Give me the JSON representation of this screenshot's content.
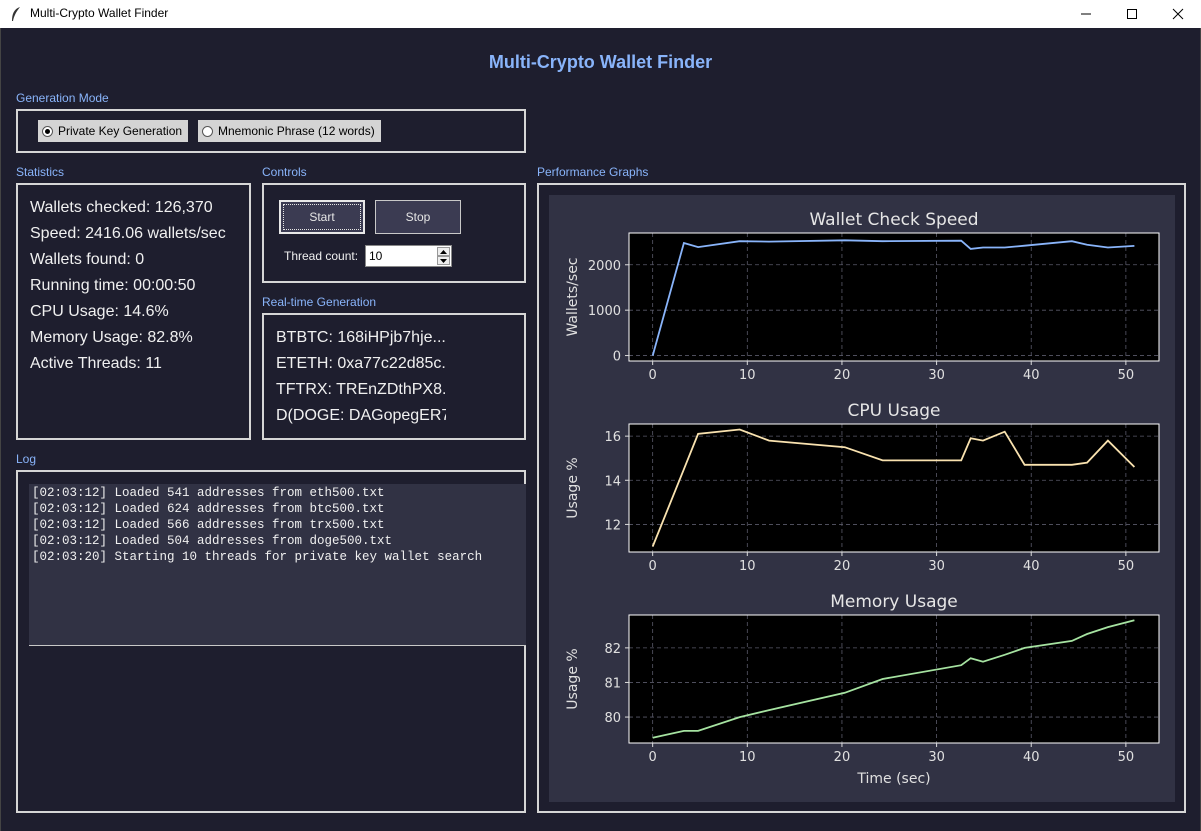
{
  "window": {
    "title": "Multi-Crypto Wallet Finder",
    "icons": [
      "feather-icon",
      "minimize-icon",
      "maximize-icon",
      "close-icon"
    ]
  },
  "heading": "Multi-Crypto Wallet Finder",
  "generation_mode": {
    "label": "Generation Mode",
    "options": [
      {
        "label": "Private Key Generation",
        "selected": true
      },
      {
        "label": "Mnemonic Phrase (12 words)",
        "selected": false
      }
    ]
  },
  "statistics": {
    "label": "Statistics",
    "lines": [
      "Wallets checked: 126,370",
      "Speed: 2416.06 wallets/sec",
      "Wallets found: 0",
      "Running time: 00:00:50",
      "CPU Usage: 14.6%",
      "Memory Usage: 82.8%",
      "Active Threads: 11"
    ]
  },
  "controls": {
    "label": "Controls",
    "start": "Start",
    "stop": "Stop",
    "thread_label": "Thread count:",
    "thread_value": "10"
  },
  "realtime": {
    "label": "Real-time Generation",
    "lines": [
      "BTBTC: 168iHPjb7hje...",
      "ETETH: 0xa77c22d85c...",
      "TFTRX: TREnZDthPX8...",
      "D(DOGE: DAGopegER7..."
    ]
  },
  "log": {
    "label": "Log",
    "lines": [
      "[02:03:12] Loaded 541 addresses from eth500.txt",
      "[02:03:12] Loaded 624 addresses from btc500.txt",
      "[02:03:12] Loaded 566 addresses from trx500.txt",
      "[02:03:12] Loaded 504 addresses from doge500.txt",
      "[02:03:20] Starting 10 threads for private key wallet search"
    ]
  },
  "graphs": {
    "label": "Performance Graphs",
    "colors": {
      "panel": "#313244",
      "plot": "#000000",
      "speed": "#89b4fa",
      "cpu": "#f9e2af",
      "memory": "#a6e3a1"
    }
  },
  "chart_data": [
    {
      "type": "line",
      "title": "Wallet Check Speed",
      "xlabel": "",
      "ylabel": "Wallets/sec",
      "x": [
        0,
        3.3,
        4.8,
        9.2,
        12.3,
        20.3,
        24.3,
        32.6,
        33.6,
        34.9,
        37.2,
        39.3,
        44.3,
        45.9,
        48.1,
        50.9
      ],
      "values": [
        0,
        2480,
        2390,
        2520,
        2510,
        2540,
        2520,
        2530,
        2350,
        2380,
        2380,
        2420,
        2520,
        2440,
        2380,
        2416
      ],
      "xticks": [
        0,
        10,
        20,
        30,
        40,
        50
      ],
      "yticks": [
        0,
        1000,
        2000
      ],
      "xlim": [
        -2.5,
        53.5
      ],
      "ylim": [
        -120,
        2700
      ],
      "grid": true
    },
    {
      "type": "line",
      "title": "CPU Usage",
      "xlabel": "",
      "ylabel": "Usage %",
      "x": [
        0,
        3.3,
        4.8,
        9.2,
        12.3,
        20.3,
        24.3,
        32.6,
        33.6,
        34.9,
        37.2,
        39.3,
        44.3,
        45.9,
        48.1,
        50.9
      ],
      "values": [
        11.0,
        14.5,
        16.1,
        16.3,
        15.8,
        15.5,
        14.9,
        14.9,
        15.9,
        15.8,
        16.2,
        14.7,
        14.7,
        14.8,
        15.8,
        14.6
      ],
      "xticks": [
        0,
        10,
        20,
        30,
        40,
        50
      ],
      "yticks": [
        12,
        14,
        16
      ],
      "xlim": [
        -2.5,
        53.5
      ],
      "ylim": [
        10.75,
        16.55
      ],
      "grid": true
    },
    {
      "type": "line",
      "title": "Memory Usage",
      "xlabel": "Time (sec)",
      "ylabel": "Usage %",
      "x": [
        0,
        3.3,
        4.8,
        9.2,
        12.3,
        20.3,
        24.3,
        32.6,
        33.6,
        34.9,
        37.2,
        39.3,
        44.3,
        45.9,
        48.1,
        50.9
      ],
      "values": [
        79.4,
        79.6,
        79.6,
        80.0,
        80.2,
        80.7,
        81.1,
        81.5,
        81.7,
        81.6,
        81.8,
        82.0,
        82.2,
        82.4,
        82.6,
        82.8
      ],
      "xticks": [
        0,
        10,
        20,
        30,
        40,
        50
      ],
      "yticks": [
        80,
        81,
        82
      ],
      "xlim": [
        -2.5,
        53.5
      ],
      "ylim": [
        79.25,
        82.95
      ],
      "grid": true
    }
  ]
}
